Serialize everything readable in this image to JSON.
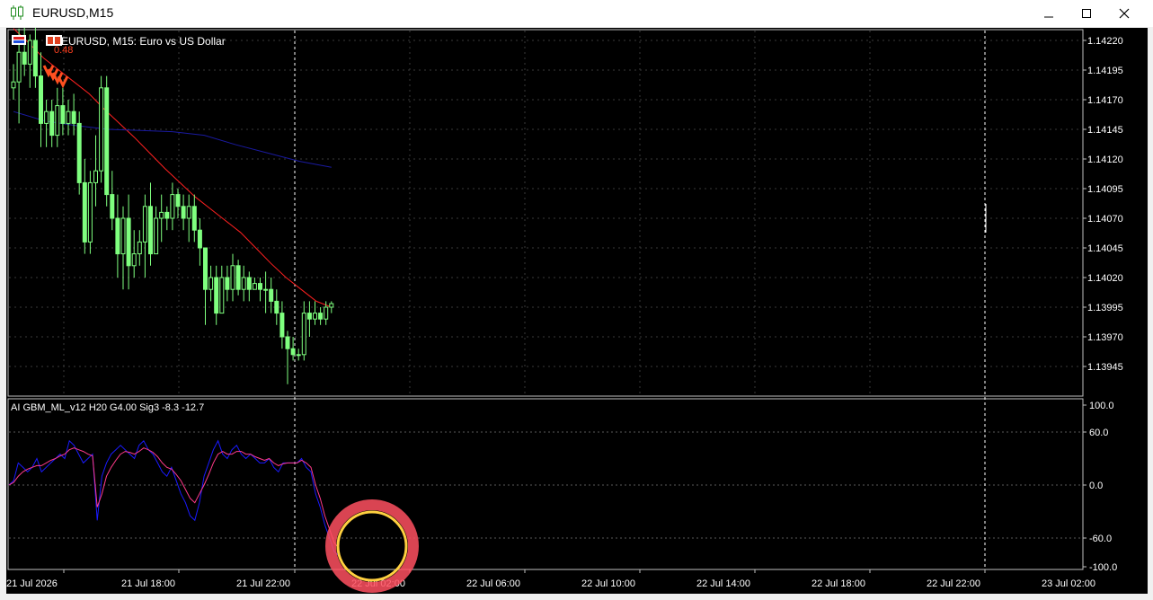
{
  "window": {
    "title": "EURUSD,M15",
    "icons": [
      "candlestick-app-icon",
      "minimize-icon",
      "maximize-icon",
      "close-icon"
    ]
  },
  "colors": {
    "background": "#000000",
    "bull_candle": "#7fff7f",
    "bear_candle": "#7fff7f",
    "ma_fast": "#ff2020",
    "ma_slow": "#1a1aa0",
    "osc_main": "#1a1aff",
    "osc_signal": "#ff3a8a",
    "grid": "#3a3a3a",
    "circle_outer": "#ff5060",
    "circle_inner": "#ffd040"
  },
  "main_pane": {
    "symbol_label": "EURUSD, M15:  Euro vs US Dollar",
    "indicator_value": "0.48",
    "price_ticks": [
      "1.14220",
      "1.14195",
      "1.14170",
      "1.14145",
      "1.14120",
      "1.14095",
      "1.14070",
      "1.14045",
      "1.14020",
      "1.13995",
      "1.13970",
      "1.13945"
    ]
  },
  "sub_pane": {
    "label": "AI GBM_ML_v12 H20 G4.00 Sig3 -8.3 -12.7",
    "ticks": [
      "100.0",
      "60.0",
      "0.0",
      "-60.0",
      "-100.0"
    ]
  },
  "time_axis": {
    "labels": [
      "21 Jul 2026",
      "21 Jul 18:00",
      "21 Jul 22:00",
      "22 Jul 02:00",
      "22 Jul 06:00",
      "22 Jul 10:00",
      "22 Jul 14:00",
      "22 Jul 18:00",
      "22 Jul 22:00",
      "23 Jul 02:00"
    ]
  },
  "chart_data": [
    {
      "type": "candlestick",
      "title": "EURUSD, M15:  Euro vs US Dollar",
      "ylim": [
        1.1392,
        1.1423
      ],
      "candles": [
        {
          "o": 1.1418,
          "h": 1.142,
          "l": 1.1417,
          "c": 1.14185
        },
        {
          "o": 1.14185,
          "h": 1.1423,
          "l": 1.1415,
          "c": 1.1421
        },
        {
          "o": 1.1421,
          "h": 1.1424,
          "l": 1.1419,
          "c": 1.142
        },
        {
          "o": 1.142,
          "h": 1.14225,
          "l": 1.1418,
          "c": 1.1422
        },
        {
          "o": 1.1422,
          "h": 1.14235,
          "l": 1.1418,
          "c": 1.1419
        },
        {
          "o": 1.1419,
          "h": 1.1421,
          "l": 1.1413,
          "c": 1.1415
        },
        {
          "o": 1.1415,
          "h": 1.1417,
          "l": 1.1413,
          "c": 1.1416
        },
        {
          "o": 1.1416,
          "h": 1.1417,
          "l": 1.1413,
          "c": 1.1414
        },
        {
          "o": 1.1414,
          "h": 1.1418,
          "l": 1.1413,
          "c": 1.14165
        },
        {
          "o": 1.14165,
          "h": 1.1418,
          "l": 1.1414,
          "c": 1.1415
        },
        {
          "o": 1.1415,
          "h": 1.1417,
          "l": 1.1414,
          "c": 1.1416
        },
        {
          "o": 1.1416,
          "h": 1.14175,
          "l": 1.1414,
          "c": 1.1415
        },
        {
          "o": 1.1415,
          "h": 1.1416,
          "l": 1.1409,
          "c": 1.141
        },
        {
          "o": 1.141,
          "h": 1.1412,
          "l": 1.1404,
          "c": 1.1405
        },
        {
          "o": 1.1405,
          "h": 1.1411,
          "l": 1.1404,
          "c": 1.141
        },
        {
          "o": 1.141,
          "h": 1.1414,
          "l": 1.1408,
          "c": 1.1411
        },
        {
          "o": 1.1411,
          "h": 1.1419,
          "l": 1.141,
          "c": 1.1418
        },
        {
          "o": 1.1418,
          "h": 1.1419,
          "l": 1.1408,
          "c": 1.1409
        },
        {
          "o": 1.1409,
          "h": 1.1411,
          "l": 1.1406,
          "c": 1.1407
        },
        {
          "o": 1.1407,
          "h": 1.1409,
          "l": 1.1402,
          "c": 1.1404
        },
        {
          "o": 1.1404,
          "h": 1.1408,
          "l": 1.1401,
          "c": 1.1407
        },
        {
          "o": 1.1407,
          "h": 1.1409,
          "l": 1.1401,
          "c": 1.1403
        },
        {
          "o": 1.1403,
          "h": 1.1406,
          "l": 1.1402,
          "c": 1.1404
        },
        {
          "o": 1.1404,
          "h": 1.1406,
          "l": 1.1403,
          "c": 1.1405
        },
        {
          "o": 1.1405,
          "h": 1.1409,
          "l": 1.1402,
          "c": 1.1408
        },
        {
          "o": 1.1408,
          "h": 1.141,
          "l": 1.1403,
          "c": 1.1404
        },
        {
          "o": 1.1404,
          "h": 1.1408,
          "l": 1.1404,
          "c": 1.1407
        },
        {
          "o": 1.1407,
          "h": 1.1409,
          "l": 1.1405,
          "c": 1.14075
        },
        {
          "o": 1.14075,
          "h": 1.1408,
          "l": 1.1406,
          "c": 1.1407
        },
        {
          "o": 1.1407,
          "h": 1.141,
          "l": 1.1406,
          "c": 1.1409
        },
        {
          "o": 1.1409,
          "h": 1.14095,
          "l": 1.1407,
          "c": 1.1408
        },
        {
          "o": 1.1408,
          "h": 1.1409,
          "l": 1.1406,
          "c": 1.1407
        },
        {
          "o": 1.1407,
          "h": 1.1409,
          "l": 1.1405,
          "c": 1.1408
        },
        {
          "o": 1.1408,
          "h": 1.1409,
          "l": 1.1405,
          "c": 1.1406
        },
        {
          "o": 1.1406,
          "h": 1.1407,
          "l": 1.1403,
          "c": 1.14045
        },
        {
          "o": 1.14045,
          "h": 1.14045,
          "l": 1.1398,
          "c": 1.1401
        },
        {
          "o": 1.1401,
          "h": 1.1403,
          "l": 1.14,
          "c": 1.1402
        },
        {
          "o": 1.1402,
          "h": 1.1403,
          "l": 1.1398,
          "c": 1.1399
        },
        {
          "o": 1.1399,
          "h": 1.1403,
          "l": 1.1399,
          "c": 1.1402
        },
        {
          "o": 1.1402,
          "h": 1.1403,
          "l": 1.14,
          "c": 1.1401
        },
        {
          "o": 1.1401,
          "h": 1.1404,
          "l": 1.14,
          "c": 1.1403
        },
        {
          "o": 1.1403,
          "h": 1.14035,
          "l": 1.14005,
          "c": 1.1401
        },
        {
          "o": 1.1401,
          "h": 1.1403,
          "l": 1.14,
          "c": 1.1402
        },
        {
          "o": 1.1402,
          "h": 1.14025,
          "l": 1.14,
          "c": 1.1401
        },
        {
          "o": 1.1401,
          "h": 1.1402,
          "l": 1.1401,
          "c": 1.14015
        },
        {
          "o": 1.14015,
          "h": 1.1402,
          "l": 1.14,
          "c": 1.1401
        },
        {
          "o": 1.1401,
          "h": 1.14025,
          "l": 1.1399,
          "c": 1.1401
        },
        {
          "o": 1.1401,
          "h": 1.1402,
          "l": 1.1399,
          "c": 1.14
        },
        {
          "o": 1.14,
          "h": 1.1401,
          "l": 1.1398,
          "c": 1.1399
        },
        {
          "o": 1.1399,
          "h": 1.14,
          "l": 1.1396,
          "c": 1.1397
        },
        {
          "o": 1.1397,
          "h": 1.13975,
          "l": 1.1393,
          "c": 1.1396
        },
        {
          "o": 1.1396,
          "h": 1.1397,
          "l": 1.1395,
          "c": 1.13955
        },
        {
          "o": 1.13955,
          "h": 1.1396,
          "l": 1.1395,
          "c": 1.13955
        },
        {
          "o": 1.13955,
          "h": 1.14,
          "l": 1.1395,
          "c": 1.1399
        },
        {
          "o": 1.1399,
          "h": 1.14,
          "l": 1.1397,
          "c": 1.13985
        },
        {
          "o": 1.13985,
          "h": 1.14,
          "l": 1.1398,
          "c": 1.1399
        },
        {
          "o": 1.1399,
          "h": 1.13995,
          "l": 1.1398,
          "c": 1.13985
        },
        {
          "o": 1.13985,
          "h": 1.14,
          "l": 1.1398,
          "c": 1.13995
        },
        {
          "o": 1.13995,
          "h": 1.14,
          "l": 1.1399,
          "c": 1.13998
        }
      ],
      "series": [
        {
          "values": [
            1.1423,
            1.14218,
            1.14205,
            1.14195,
            1.14185,
            1.14175,
            1.14162,
            1.1415,
            1.14138,
            1.14125,
            1.14112,
            1.141,
            1.14088,
            1.14078,
            1.14068,
            1.14058,
            1.14045,
            1.14032,
            1.1402,
            1.1401,
            1.14,
            1.13995
          ]
        },
        {
          "values": [
            1.1416,
            1.14152,
            1.14148,
            1.14145,
            1.14144,
            1.14143,
            1.1414,
            1.14132,
            1.14125,
            1.14118,
            1.14113
          ]
        }
      ]
    },
    {
      "type": "line",
      "title": "AI GBM_ML_v12 H20 G4.00 Sig3 -8.3 -12.7",
      "ylim": [
        -100,
        100
      ],
      "series": [
        {
          "values": [
            0,
            5,
            25,
            20,
            15,
            20,
            30,
            15,
            20,
            25,
            30,
            35,
            30,
            50,
            45,
            35,
            25,
            30,
            35,
            -40,
            10,
            25,
            35,
            40,
            45,
            40,
            35,
            30,
            45,
            50,
            40,
            35,
            25,
            15,
            10,
            20,
            5,
            -10,
            -20,
            -35,
            -40,
            -20,
            10,
            25,
            40,
            50,
            35,
            30,
            40,
            45,
            35,
            30,
            35,
            30,
            25,
            25,
            30,
            20,
            15,
            25,
            25,
            25,
            25,
            30,
            20,
            15,
            -10,
            -25,
            -45,
            -60,
            -75,
            -80
          ]
        },
        {
          "values": [
            0,
            3,
            10,
            15,
            18,
            20,
            22,
            22,
            25,
            28,
            30,
            33,
            35,
            40,
            42,
            40,
            38,
            35,
            33,
            -25,
            -10,
            10,
            20,
            28,
            35,
            38,
            37,
            35,
            38,
            42,
            40,
            37,
            32,
            25,
            20,
            18,
            12,
            5,
            -5,
            -15,
            -20,
            -10,
            0,
            12,
            25,
            35,
            38,
            35,
            35,
            38,
            38,
            35,
            35,
            32,
            30,
            28,
            30,
            25,
            22,
            24,
            25,
            25,
            25,
            28,
            25,
            20,
            0,
            -15,
            -35,
            -50,
            -65,
            -72
          ]
        }
      ]
    }
  ]
}
